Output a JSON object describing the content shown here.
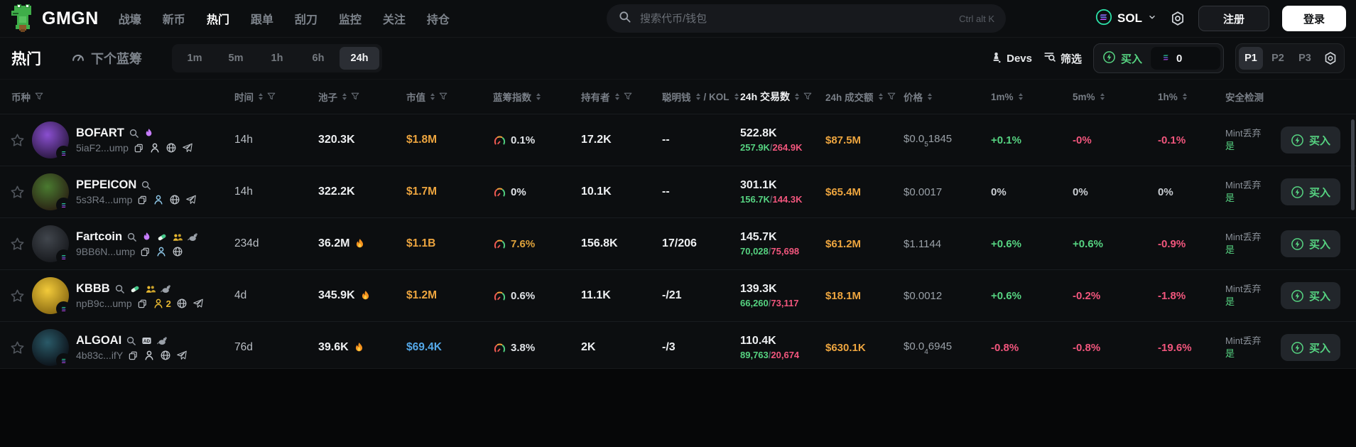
{
  "topbar": {
    "logo_text": "GMGN",
    "nav": [
      {
        "label": "战壕",
        "active": false
      },
      {
        "label": "新币",
        "active": false
      },
      {
        "label": "热门",
        "active": true
      },
      {
        "label": "跟单",
        "active": false
      },
      {
        "label": "刮刀",
        "active": false
      },
      {
        "label": "监控",
        "active": false
      },
      {
        "label": "关注",
        "active": false
      },
      {
        "label": "持仓",
        "active": false
      }
    ],
    "search": {
      "placeholder": "搜索代币/钱包",
      "shortcut": "Ctrl alt K"
    },
    "chain": {
      "label": "SOL"
    },
    "signup_label": "注册",
    "login_label": "登录"
  },
  "toolbar": {
    "title": "热门",
    "next_bluechip_label": "下个蓝筹",
    "timeframes": [
      "1m",
      "5m",
      "1h",
      "6h",
      "24h"
    ],
    "active_timeframe": "24h",
    "devs_label": "Devs",
    "filter_label": "筛选",
    "buy_label": "买入",
    "buy_amount": "0",
    "presets": [
      "P1",
      "P2",
      "P3"
    ],
    "active_preset": "P1"
  },
  "table": {
    "buy_button_label": "买入",
    "columns": [
      {
        "label": "币种",
        "filter": true
      },
      {
        "label": "时间",
        "sort": true,
        "filter": true
      },
      {
        "label": "池子",
        "sort": true,
        "filter": true
      },
      {
        "label": "市值",
        "sort": true,
        "filter": true
      },
      {
        "label": "蓝筹指数",
        "sort": true
      },
      {
        "label": "持有者",
        "sort": true,
        "filter": true
      },
      {
        "label": "聪明钱",
        "label2": "/ KOL",
        "dual": true
      },
      {
        "label": "24h 交易数",
        "sort": true,
        "filter": true,
        "strong": true
      },
      {
        "label": "24h 成交额",
        "sort": true,
        "filter": true
      },
      {
        "label": "价格",
        "sort": true
      },
      {
        "label": "1m%",
        "sort": true
      },
      {
        "label": "5m%",
        "sort": true
      },
      {
        "label": "1h%",
        "sort": true
      },
      {
        "label": "安全检测"
      },
      {
        "label": ""
      }
    ],
    "rows": [
      {
        "symbol": "BOFART",
        "address": "5iaF2...ump",
        "age": "14h",
        "avatar": [
          "#8a4fd0",
          "#2a1840"
        ],
        "badges": [
          "flame"
        ],
        "links": {
          "copy": true,
          "person": true,
          "person_color": "#c6cbd1",
          "person_count": "",
          "globe": true,
          "telegram": true
        },
        "pool": "320.3K",
        "pool_burn": false,
        "mcap": "$1.8M",
        "mcap_tone": "gold",
        "bluechip": "0.1%",
        "bluechip_tone": "normal",
        "holders": "17.2K",
        "smart_kol": "--",
        "tx_total": "522.8K",
        "tx_buys": "257.9K",
        "tx_sells": "264.9K",
        "volume": "$87.5M",
        "price": {
          "pre": "$0.0",
          "sub": "5",
          "post": "1845"
        },
        "chg_1m": "+0.1%",
        "chg_5m": "-0%",
        "chg_1h": "-0.1%",
        "safety_label": "Mint丢弃",
        "safety_value": "是"
      },
      {
        "symbol": "PEPEICON",
        "address": "5s3R4...ump",
        "age": "14h",
        "avatar": [
          "#4a7a30",
          "#2a2214"
        ],
        "badges": [],
        "links": {
          "copy": true,
          "person": true,
          "person_color": "#8ec7e8",
          "person_count": "",
          "globe": true,
          "telegram": true
        },
        "pool": "322.2K",
        "pool_burn": false,
        "mcap": "$1.7M",
        "mcap_tone": "gold",
        "bluechip": "0%",
        "bluechip_tone": "normal",
        "holders": "10.1K",
        "smart_kol": "--",
        "tx_total": "301.1K",
        "tx_buys": "156.7K",
        "tx_sells": "144.3K",
        "volume": "$65.4M",
        "price": {
          "pre": "$0.0017",
          "sub": "",
          "post": ""
        },
        "chg_1m": "0%",
        "chg_5m": "0%",
        "chg_1h": "0%",
        "safety_label": "Mint丢弃",
        "safety_value": "是"
      },
      {
        "symbol": "Fartcoin",
        "address": "9BB6N...ump",
        "age": "234d",
        "avatar": [
          "#41464d",
          "#17191d"
        ],
        "badges": [
          "flame",
          "pill",
          "users",
          "rat"
        ],
        "links": {
          "copy": true,
          "person": true,
          "person_color": "#8ec7e8",
          "person_count": "",
          "globe": true,
          "telegram": false
        },
        "pool": "36.2M",
        "pool_burn": true,
        "mcap": "$1.1B",
        "mcap_tone": "gold",
        "bluechip": "7.6%",
        "bluechip_tone": "warn",
        "holders": "156.8K",
        "smart_kol": "17/206",
        "tx_total": "145.7K",
        "tx_buys": "70,028",
        "tx_sells": "75,698",
        "volume": "$61.2M",
        "price": {
          "pre": "$1.1144",
          "sub": "",
          "post": ""
        },
        "chg_1m": "+0.6%",
        "chg_5m": "+0.6%",
        "chg_1h": "-0.9%",
        "safety_label": "Mint丢弃",
        "safety_value": "是"
      },
      {
        "symbol": "KBBB",
        "address": "npB9c...ump",
        "age": "4d",
        "avatar": [
          "#f2ca3a",
          "#8a6a12"
        ],
        "badges": [
          "pill",
          "users",
          "rat"
        ],
        "links": {
          "copy": true,
          "person": true,
          "person_color": "#e8b931",
          "person_count": "2",
          "globe": true,
          "telegram": true
        },
        "pool": "345.9K",
        "pool_burn": true,
        "mcap": "$1.2M",
        "mcap_tone": "gold",
        "bluechip": "0.6%",
        "bluechip_tone": "normal",
        "holders": "11.1K",
        "smart_kol": "-/21",
        "tx_total": "139.3K",
        "tx_buys": "66,260",
        "tx_sells": "73,117",
        "volume": "$18.1M",
        "price": {
          "pre": "$0.0012",
          "sub": "",
          "post": ""
        },
        "chg_1m": "+0.6%",
        "chg_5m": "-0.2%",
        "chg_1h": "-1.8%",
        "safety_label": "Mint丢弃",
        "safety_value": "是"
      },
      {
        "symbol": "ALGOAI",
        "address": "4b83c...ifY",
        "age": "76d",
        "avatar": [
          "#2a5a68",
          "#0c1118"
        ],
        "badges": [
          "ad",
          "rat"
        ],
        "links": {
          "copy": true,
          "person": true,
          "person_color": "#c6cbd1",
          "person_count": "",
          "globe": true,
          "telegram": true
        },
        "pool": "39.6K",
        "pool_burn": true,
        "mcap": "$69.4K",
        "mcap_tone": "blue",
        "bluechip": "3.8%",
        "bluechip_tone": "normal",
        "holders": "2K",
        "smart_kol": "-/3",
        "tx_total": "110.4K",
        "tx_buys": "89,763",
        "tx_sells": "20,674",
        "volume": "$630.1K",
        "price": {
          "pre": "$0.0",
          "sub": "4",
          "post": "6945"
        },
        "chg_1m": "-0.8%",
        "chg_5m": "-0.8%",
        "chg_1h": "-19.6%",
        "safety_label": "Mint丢弃",
        "safety_value": "是"
      }
    ]
  },
  "colors": {
    "green": "#56d381",
    "red": "#f2567d",
    "gold": "#eda53f",
    "blue_mcap": "#54a8e8",
    "purple_flame": "#c77dff",
    "yellow_users": "#e8b931",
    "background": "#0c0e10"
  }
}
